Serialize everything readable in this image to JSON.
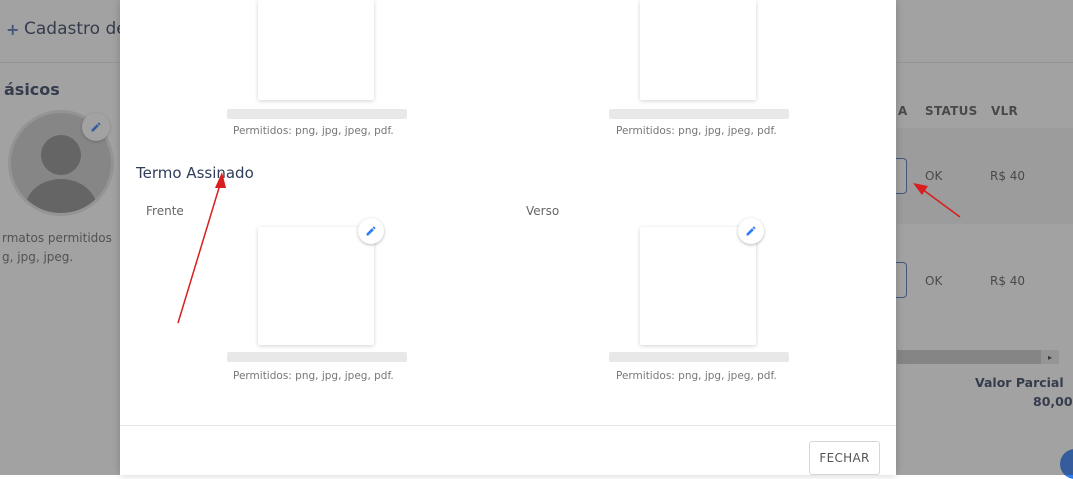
{
  "background": {
    "header_title": "Cadastro de",
    "section_title": "ásicos",
    "avatar_formats_line1": "rmatos permitidos",
    "avatar_formats_line2": "g, jpg, jpeg.",
    "table": {
      "headers": [
        "A",
        "STATUS",
        "VLR"
      ],
      "rows": [
        {
          "status": "OK",
          "value": "R$ 40"
        },
        {
          "status": "OK",
          "value": "R$ 40"
        }
      ]
    },
    "partial_label": "Valor Parcial",
    "partial_value": "80,00",
    "scroll_arrow": "▸"
  },
  "modal": {
    "top_allowed_left": "Permitidos: png, jpg, jpeg, pdf.",
    "top_allowed_right": "Permitidos: png, jpg, jpeg, pdf.",
    "section_title": "Termo Assinado",
    "front_label": "Frente",
    "back_label": "Verso",
    "bottom_allowed_left": "Permitidos: png, jpg, jpeg, pdf.",
    "bottom_allowed_right": "Permitidos: png, jpg, jpeg, pdf.",
    "close_label": "FECHAR"
  },
  "colors": {
    "accent": "#2f7cf6",
    "annotation_arrow": "#d81e1e",
    "title_text": "#2f3d5a"
  },
  "icons": {
    "edit": "pencil-icon",
    "header_add": "plus-icon"
  }
}
